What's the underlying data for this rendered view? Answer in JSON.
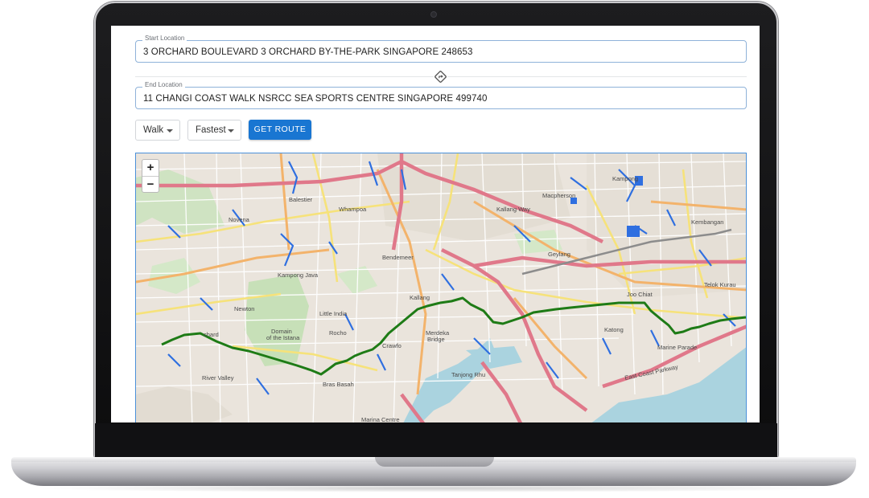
{
  "route_form": {
    "start_label": "Start Location",
    "start_value": "3 ORCHARD BOULEVARD 3 ORCHARD BY-THE-PARK SINGAPORE 248653",
    "end_label": "End Location",
    "end_value": "11 CHANGI COAST WALK NSRCC SEA SPORTS CENTRE SINGAPORE 499740",
    "swap_icon": "directions-icon",
    "mode_select": "Walk",
    "preference_select": "Fastest",
    "submit_label": "GET ROUTE"
  },
  "map": {
    "zoom_in": "+",
    "zoom_out": "−",
    "route_color": "#1e7b16",
    "accent_color": "#1976d2",
    "place_labels": {
      "balestier": "Balestier",
      "whampoa": "Whampoa",
      "novena": "Novena",
      "kallang_way": "Kallang Way",
      "macpherson": "Macpherson",
      "kampong": "Kampong",
      "kembangan": "Kembangan",
      "bendemeer": "Bendemeer",
      "geylang": "Geylang",
      "kampong_java": "Kampong Java",
      "newton": "Newton",
      "little_india": "Little India",
      "kallang": "Kallang",
      "joo_chiat": "Joo Chiat",
      "telok_kurau": "Telok Kurau",
      "domain": "Domain",
      "of_the_istana": "of the Istana",
      "rochor": "Rocho",
      "crawford": "Crawfo",
      "merdeka_bridge_1": "Merdeka",
      "merdeka_bridge_2": "Bridge",
      "katong": "Katong",
      "marine_parade": "Marine Parade",
      "orchard": "chard",
      "river_valley": "River Valley",
      "tanjong_rhu": "Tanjong Rhu",
      "bras_basah": "Bras Basah",
      "marina_centre": "Marina Centre",
      "east_coast_parkway": "East Coast Parkway"
    }
  }
}
